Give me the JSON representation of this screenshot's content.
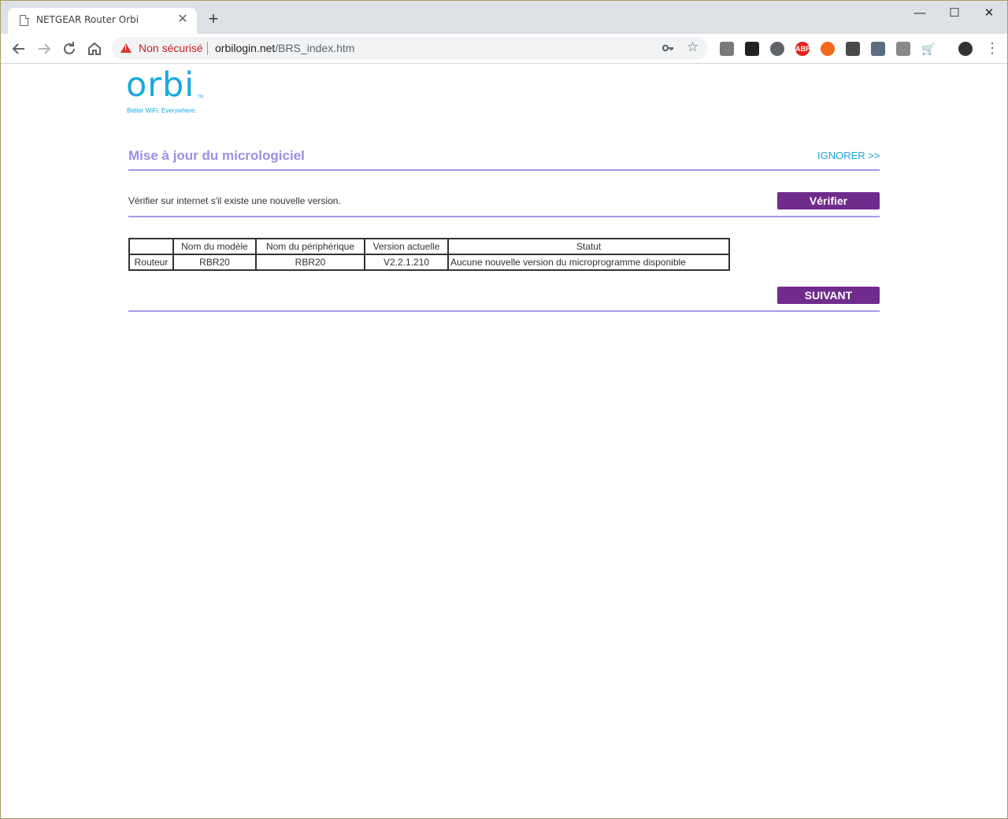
{
  "browser": {
    "tab_title": "NETGEAR Router Orbi",
    "tab_close": "✕",
    "new_tab": "+",
    "security_label": "Non sécurisé",
    "url_host": "orbilogin.net",
    "url_path": "/BRS_index.htm",
    "window_controls": [
      "—",
      "☐",
      "✕"
    ],
    "extensions": [
      {
        "icon": "puzzle-hand-icon",
        "label": "",
        "color": "#7a7a7a"
      },
      {
        "icon": "tampermonkey-icon",
        "label": "",
        "color": "#222222"
      },
      {
        "icon": "extension-x-icon",
        "label": "",
        "color": "#5f6368"
      },
      {
        "icon": "adblock-plus-icon",
        "label": "ABP",
        "color": "#e2231a"
      },
      {
        "icon": "orange-diamond-icon",
        "label": "",
        "color": "#f26a1b"
      },
      {
        "icon": "lens-icon",
        "label": "",
        "color": "#4a4a4a"
      },
      {
        "icon": "web-scrap-icon",
        "label": "",
        "color": "#5a6e7f"
      },
      {
        "icon": "gmail-checker-icon",
        "label": "",
        "color": "#8a8a8a"
      },
      {
        "icon": "cart-icon",
        "label": "",
        "color": "#e53935"
      }
    ]
  },
  "logo": {
    "word": "orbi",
    "tm": "TM",
    "tagline": "Better WiFi. Everywhere."
  },
  "page": {
    "title": "Mise à jour du micrologiciel",
    "ignore_link": "IGNORER >>",
    "check_text": "Vérifier sur internet s'il existe une nouvelle version.",
    "check_button": "Vérifier",
    "next_button": "SUIVANT"
  },
  "table": {
    "headers": [
      "",
      "Nom du modèle",
      "Nom du périphérique",
      "Version actuelle",
      "Statut"
    ],
    "rows": [
      [
        "Routeur",
        "RBR20",
        "RBR20",
        "V2.2.1.210",
        "Aucune nouvelle version du microprogramme disponible"
      ]
    ]
  },
  "colors": {
    "accent_purple": "#6f2c8c",
    "title_lavender": "#9a8fe6",
    "rule": "#a59ae6",
    "link_blue": "#1ea4d8",
    "logo_blue": "#18a9dd"
  }
}
